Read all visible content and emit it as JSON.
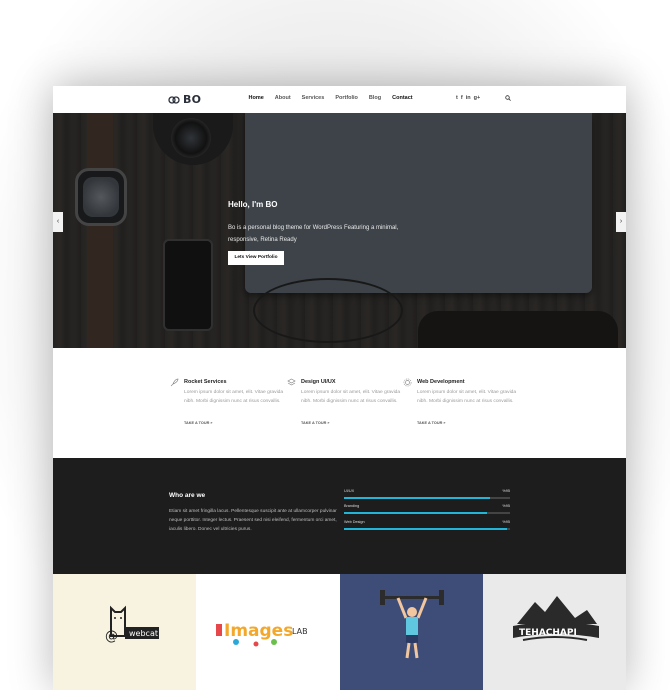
{
  "header": {
    "logo_text": "BO",
    "nav": [
      "Home",
      "About",
      "Services",
      "Portfolio",
      "Blog",
      "Contact"
    ],
    "social": [
      "twitter-icon",
      "facebook-icon",
      "linkedin-icon",
      "google-plus-icon"
    ]
  },
  "hero": {
    "title": "Hello, I'm BO",
    "description": "Bo is a personal blog theme for WordPress Featuring a minimal, responsive, Retina Ready",
    "button_label": "Lets View Portfolio",
    "prev_arrow": "‹",
    "next_arrow": "›"
  },
  "services": [
    {
      "title": "Rocket Services",
      "text": "Lorem ipsum dolor sit amet, elit. Vitae gravida nibh. Morbi dignissim nunc at risus convallis.",
      "link": "TAKE A TOUR »",
      "icon": "rocket-icon"
    },
    {
      "title": "Design UI/UX",
      "text": "Lorem ipsum dolor sit amet, elit. Vitae gravida nibh. Morbi dignissim nunc at risus convallis.",
      "link": "TAKE A TOUR »",
      "icon": "layers-icon"
    },
    {
      "title": "Web Development",
      "text": "Lorem ipsum dolor sit amet, elit. Vitae gravida nibh. Morbi dignissim nunc at risus convallis.",
      "link": "TAKE A TOUR »",
      "icon": "gear-icon"
    }
  ],
  "who": {
    "title": "Who are we",
    "text": "Etiam sit amet fringilla lacus. Pellentesque suscipit ante at ullamcorper pulvinar neque porttitor. Integer lectus. Praesent sed nisi eleifend, fermentum orci amet, iaculis libero. Donec vel ultricies purus.",
    "skills": [
      {
        "name": "UI/UX",
        "pct_label": "%95",
        "value": 0.88
      },
      {
        "name": "Branding",
        "pct_label": "%95",
        "value": 0.86
      },
      {
        "name": "Web Design",
        "pct_label": "%95",
        "value": 0.98
      }
    ]
  },
  "portfolio": [
    {
      "label": "webcat",
      "symbol": "@",
      "icon": "cat-icon",
      "bg": "#f8f3e1"
    },
    {
      "label": "Images",
      "sub": "LAB",
      "icon": "paint-icon",
      "bg": "#ffffff"
    },
    {
      "label": "",
      "icon": "weightlifter-icon",
      "bg": "#3d4d78"
    },
    {
      "label": "TEHACHAPI",
      "icon": "mountain-icon",
      "bg": "#eaeaea"
    }
  ],
  "colors": {
    "accent": "#23b5d8",
    "dark": "#1d1d1d"
  }
}
